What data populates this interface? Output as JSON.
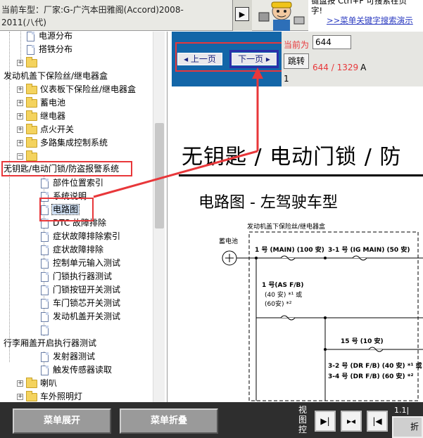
{
  "header": {
    "car_title": "当前车型：厂家:G-广汽本田雅阁(Accord)2008-2011(八代)",
    "nav_toggle_icon": "play-arrow-icon",
    "tip_line1": "键盘按  Ctrl+F  可搜索在页",
    "tip_line2": "字!",
    "tip_link": ">>菜单关键字搜索演示"
  },
  "tree": {
    "items": [
      {
        "label": "电源分布"
      },
      {
        "label": "搭铁分布"
      },
      {
        "label": ""
      },
      {
        "label": "发动机盖下保险丝/继电器盒"
      },
      {
        "label": "仪表板下保险丝/继电器盒"
      },
      {
        "label": "蓄电池"
      },
      {
        "label": "继电器"
      },
      {
        "label": "点火开关"
      },
      {
        "label": "多路集成控制系统"
      },
      {
        "label": ""
      },
      {
        "label": "无钥匙/电动门锁/防盗报警系统"
      },
      {
        "label": "部件位置索引"
      },
      {
        "label": "系统说明"
      },
      {
        "label": "电路图"
      },
      {
        "label": "DTC 故障排除"
      },
      {
        "label": "症状故障排除索引"
      },
      {
        "label": "症状故障排除"
      },
      {
        "label": "控制单元输入测试"
      },
      {
        "label": "门锁执行器测试"
      },
      {
        "label": "门锁按钮开关测试"
      },
      {
        "label": "车门锁芯开关测试"
      },
      {
        "label": "发动机盖开关测试"
      },
      {
        "label": ""
      },
      {
        "label": "行李厢盖开启执行器测试"
      },
      {
        "label": "发射器测试"
      },
      {
        "label": "触发传感器读取"
      },
      {
        "label": "喇叭"
      },
      {
        "label": "车外照明灯"
      }
    ]
  },
  "nav": {
    "prev_label": "上一页",
    "next_label": "下一页",
    "page_label": "当前为",
    "page_value": "644",
    "jump_label": "跳转",
    "page_count": "644 / 1329",
    "page_count_suffix": "A",
    "page_one": "1"
  },
  "doc": {
    "title": "无钥匙 / 电动门锁 / 防",
    "subtitle": "电路图 - 左驾驶车型",
    "diagram": {
      "box_label": "发动机盖下保险丝/继电器盒",
      "battery_label": "蓄电池",
      "fuse_main": "1 号 (MAIN) (100 安)",
      "fuse_ig": "3-1 号 (IG MAIN) (50 安)",
      "fuse_asfb": "1 号(AS F/B)",
      "fuse_asfb_a": "(40 安) *¹ 或",
      "fuse_asfb_b": "(60安) *²",
      "fuse_15": "15 号 (10 安)",
      "fuse_32": "3-2 号 (DR F/B) (40 安) *¹ 或",
      "fuse_34": "3-4 号 (DR F/B) (60 安) *²"
    }
  },
  "bottom": {
    "expand_label": "菜单展开",
    "collapse_label": "菜单折叠",
    "view_ctrl_label": "视图控",
    "version": "1.1|",
    "corner_label": "折"
  },
  "colors": {
    "nav_blue": "#1366a8",
    "highlight_red": "#e8373a",
    "next_box_blue": "#2b2ea8",
    "bottom_bar": "#2e2e2e"
  }
}
